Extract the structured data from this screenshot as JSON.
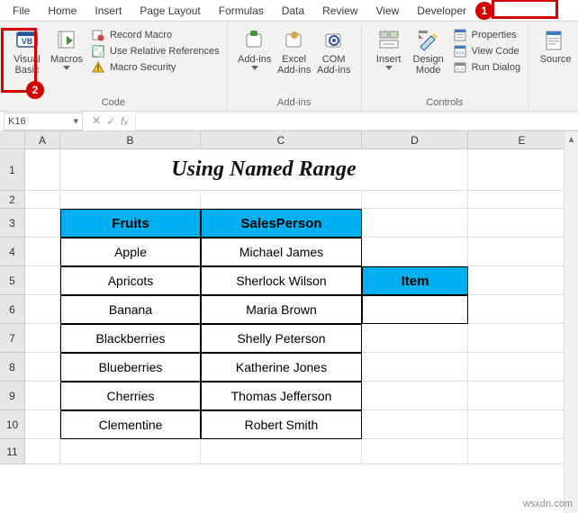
{
  "tabs": {
    "file": "File",
    "home": "Home",
    "insert": "Insert",
    "pagelayout": "Page Layout",
    "formulas": "Formulas",
    "data": "Data",
    "review": "Review",
    "view": "View",
    "developer": "Developer"
  },
  "ribbon": {
    "code": {
      "visual_basic": "Visual Basic",
      "macros": "Macros",
      "record_macro": "Record Macro",
      "use_relative": "Use Relative References",
      "macro_security": "Macro Security",
      "group": "Code"
    },
    "addins": {
      "addins": "Add-ins",
      "excel_addins": "Excel Add-ins",
      "com_addins": "COM Add-ins",
      "group": "Add-ins"
    },
    "controls": {
      "insert": "Insert",
      "design_mode": "Design Mode",
      "properties": "Properties",
      "view_code": "View Code",
      "run_dialog": "Run Dialog",
      "group": "Controls"
    },
    "xml": {
      "source": "Source"
    }
  },
  "namebox": "K16",
  "formula": "",
  "columns": [
    "A",
    "B",
    "C",
    "D",
    "E"
  ],
  "row_nums": [
    1,
    2,
    3,
    4,
    5,
    6,
    7,
    8,
    9,
    10,
    11
  ],
  "sheet": {
    "title": "Using Named Range",
    "headers": {
      "fruits": "Fruits",
      "salesperson": "SalesPerson"
    },
    "rows": [
      {
        "fruit": "Apple",
        "person": "Michael James"
      },
      {
        "fruit": "Apricots",
        "person": "Sherlock Wilson"
      },
      {
        "fruit": "Banana",
        "person": "Maria Brown"
      },
      {
        "fruit": "Blackberries",
        "person": "Shelly Peterson"
      },
      {
        "fruit": "Blueberries",
        "person": "Katherine Jones"
      },
      {
        "fruit": "Cherries",
        "person": "Thomas Jefferson"
      },
      {
        "fruit": "Clementine",
        "person": "Robert Smith"
      }
    ],
    "item_header": "Item"
  },
  "annot": {
    "badge1": "1",
    "badge2": "2"
  },
  "watermark": "wsxdn.com"
}
